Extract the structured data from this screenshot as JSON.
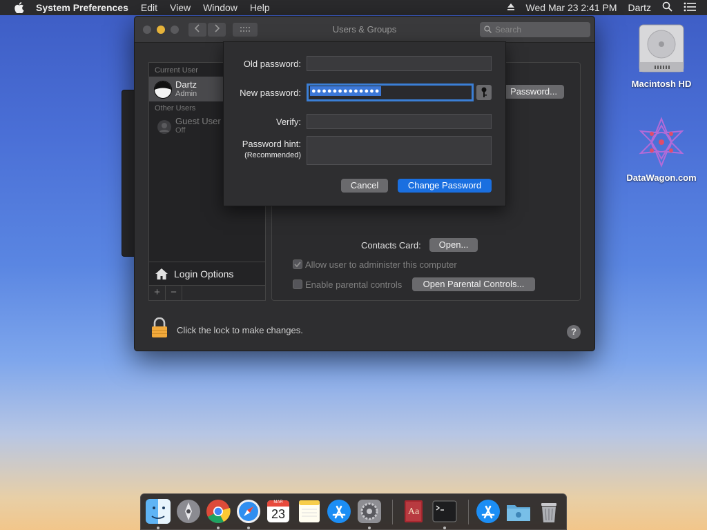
{
  "menubar": {
    "app_name": "System Preferences",
    "menus": [
      "Edit",
      "View",
      "Window",
      "Help"
    ],
    "datetime": "Wed Mar 23  2:41 PM",
    "user": "Dartz"
  },
  "desktop": {
    "icons": [
      {
        "label": "Macintosh HD"
      },
      {
        "label": "DataWagon.com"
      }
    ]
  },
  "window": {
    "title": "Users & Groups",
    "search_placeholder": "Search",
    "sidebar": {
      "current_user_header": "Current User",
      "current_user": {
        "name": "Dartz",
        "role": "Admin"
      },
      "other_users_header": "Other Users",
      "other_users": [
        {
          "name": "Guest User",
          "status": "Off"
        }
      ],
      "login_options_label": "Login Options",
      "add_label": "+",
      "remove_label": "−"
    },
    "panel": {
      "password_button": "Password...",
      "contacts_card_label": "Contacts Card:",
      "open_button": "Open...",
      "allow_admin_label": "Allow user to administer this computer",
      "parental_controls_label": "Enable parental controls",
      "open_parental_button": "Open Parental Controls..."
    },
    "lock_text": "Click the lock to make changes.",
    "help_label": "?"
  },
  "sheet": {
    "old_password_label": "Old password:",
    "new_password_label": "New password:",
    "new_password_value": "●●●●●●●●●●●●●",
    "verify_label": "Verify:",
    "hint_label": "Password hint:",
    "hint_sub": "(Recommended)",
    "cancel_button": "Cancel",
    "change_button": "Change Password"
  },
  "colors": {
    "accent": "#1a6fe0",
    "window_bg": "#2e2e30",
    "traffic_close": "#5a5a5d",
    "traffic_min": "#e6b33a"
  },
  "dock": {
    "apps": [
      "finder-icon",
      "launchpad-icon",
      "chrome-icon",
      "safari-icon",
      "calendar-icon",
      "notes-icon",
      "app-store-icon",
      "system-preferences-icon",
      "dictionary-icon",
      "terminal-icon",
      "app-store-folder-icon",
      "folder-icon",
      "trash-icon"
    ],
    "calendar_month": "MAR",
    "calendar_day": "23"
  }
}
